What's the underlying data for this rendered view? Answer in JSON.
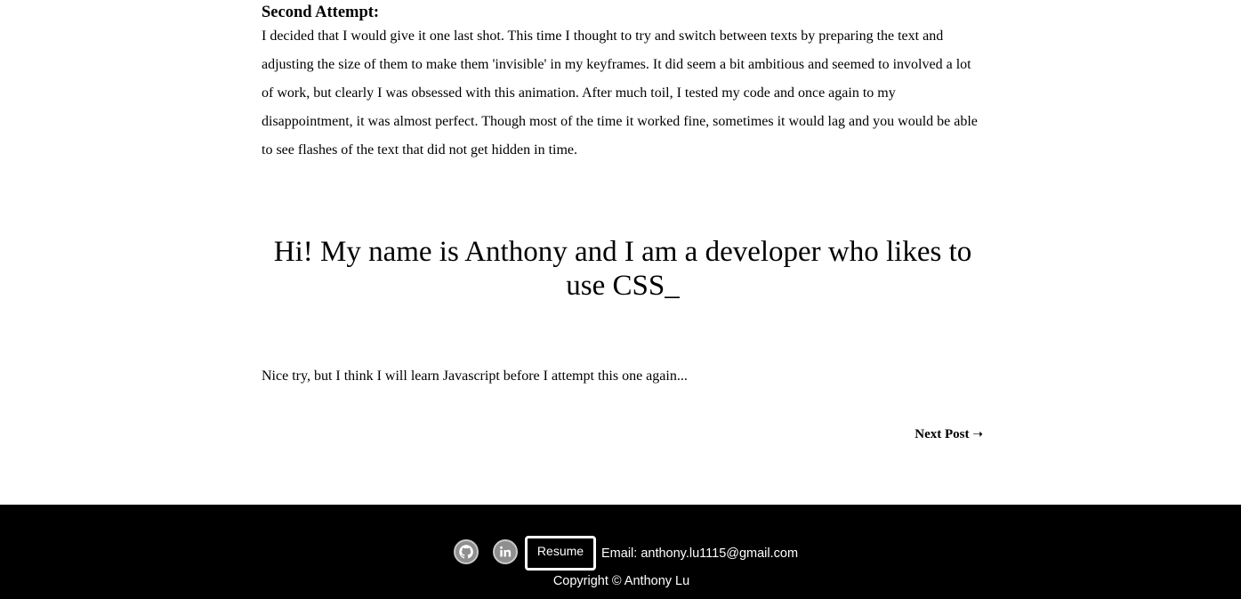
{
  "article": {
    "heading": "Second Attempt:",
    "paragraph": "I decided that I would give it one last shot. This time I thought to try and switch between texts by preparing the text and adjusting the size of them to make them 'invisible' in my keyframes. It did seem a bit ambitious and seemed to involved a lot of work, but clearly I was obsessed with this animation. After much toil, I tested my code and once again to my disappointment, it was almost perfect. Though most of the time it worked fine, sometimes it would lag and you would be able to see flashes of the text that did not get hidden in time.",
    "demo_text": "Hi! My name is Anthony and I am a developer who likes to use CSS_",
    "closing": "Nice try, but I think I will learn Javascript before I attempt this one again...",
    "next_post_label": "Next Post",
    "next_post_arrow": "➝"
  },
  "footer": {
    "icons": [
      "github-icon",
      "linkedin-icon"
    ],
    "resume_label": "Resume",
    "email": "Email: anthony.lu1115@gmail.com",
    "copyright": "Copyright © Anthony Lu"
  },
  "colors": {
    "background": "#ffffff",
    "text": "#000000",
    "footer_background": "#000000",
    "footer_text": "#ffffff",
    "icon_fill": "#8f8f8f"
  }
}
